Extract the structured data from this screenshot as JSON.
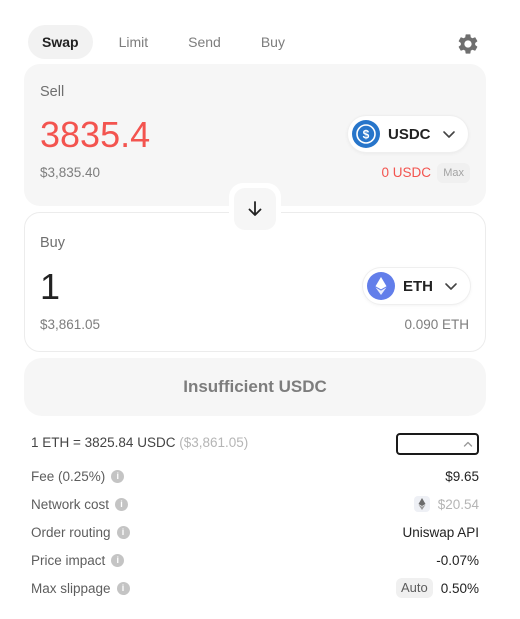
{
  "tabs": [
    {
      "label": "Swap",
      "active": true
    },
    {
      "label": "Limit",
      "active": false
    },
    {
      "label": "Send",
      "active": false
    },
    {
      "label": "Buy",
      "active": false
    }
  ],
  "settings_icon": "gear-icon",
  "sell": {
    "label": "Sell",
    "amount": "3835.4",
    "usd_value": "$3,835.40",
    "token": {
      "symbol": "USDC",
      "icon": "usdc-icon",
      "color": "#2775ca"
    },
    "balance": "0 USDC",
    "max_label": "Max"
  },
  "switch_icon": "arrow-down-icon",
  "buy": {
    "label": "Buy",
    "amount": "1",
    "usd_value": "$3,861.05",
    "token": {
      "symbol": "ETH",
      "icon": "eth-icon",
      "color": "#627eea"
    },
    "balance": "0.090 ETH"
  },
  "cta_label": "Insufficient USDC",
  "rate": {
    "text": "1 ETH = 3825.84 USDC",
    "usd": "($3,861.05)"
  },
  "details": [
    {
      "label": "Fee (0.25%)",
      "value": "$9.65"
    },
    {
      "label": "Network cost",
      "value": "$20.54"
    },
    {
      "label": "Order routing",
      "value": "Uniswap API"
    },
    {
      "label": "Price impact",
      "value": "-0.07%"
    },
    {
      "label": "Max slippage",
      "badge": "Auto",
      "value": "0.50%"
    }
  ],
  "colors": {
    "accent_red": "#f3544f",
    "card_bg": "#f6f6f6",
    "muted_text": "#7d7d7d"
  }
}
